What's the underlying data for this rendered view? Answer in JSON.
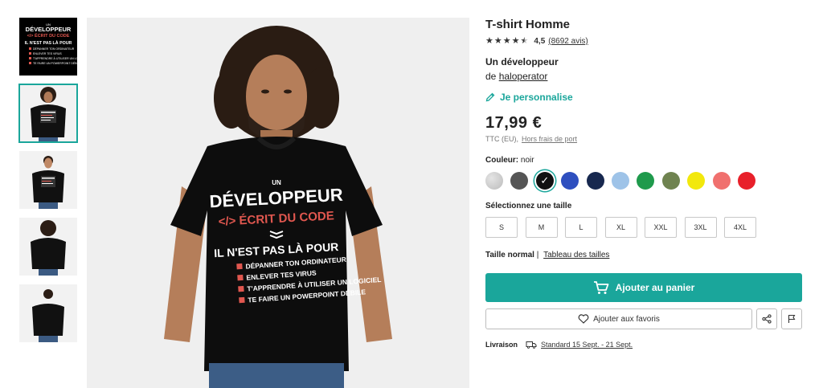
{
  "product": {
    "title": "T-shirt Homme",
    "rating_value": "4,5",
    "rating_count": "(8692 avis)",
    "design_name": "Un développeur",
    "designer_prefix": "de",
    "designer_name": "haloperator",
    "personalise_label": "Je personnalise",
    "price": "17,99 €",
    "price_tax_note": "TTC (EU),",
    "price_shipping_link": "Hors frais de port"
  },
  "color": {
    "label": "Couleur:",
    "selected_name": "noir",
    "swatches": [
      {
        "name": "heather-grey",
        "hex": "#c9c9c9"
      },
      {
        "name": "dark-grey",
        "hex": "#555555"
      },
      {
        "name": "black",
        "hex": "#111111"
      },
      {
        "name": "royal-blue",
        "hex": "#2e4fbf"
      },
      {
        "name": "navy",
        "hex": "#17284f"
      },
      {
        "name": "light-blue",
        "hex": "#9ec3e8"
      },
      {
        "name": "green",
        "hex": "#1f9a4c"
      },
      {
        "name": "olive",
        "hex": "#6f8350"
      },
      {
        "name": "yellow",
        "hex": "#f2e80c"
      },
      {
        "name": "coral",
        "hex": "#f0706e"
      },
      {
        "name": "red",
        "hex": "#e8202a"
      }
    ]
  },
  "size": {
    "label": "Sélectionnez une taille",
    "options": [
      "S",
      "M",
      "L",
      "XL",
      "XXL",
      "3XL",
      "4XL"
    ],
    "fit_label": "Taille normal",
    "fit_separator": "|",
    "size_chart_link": "Tableau des tailles"
  },
  "actions": {
    "add_to_cart": "Ajouter au panier",
    "add_to_favorites": "Ajouter aux favoris"
  },
  "delivery": {
    "label": "Livraison",
    "value": "Standard 15 Sept. - 21 Sept."
  },
  "design_print": {
    "line1": "UN",
    "line2": "DÉVELOPPEUR",
    "line3": "</> ÉCRIT DU CODE",
    "line4": "IL N'EST PAS LÀ POUR",
    "items": [
      "DÉPANNER TON ORDINATEUR",
      "ENLEVER TES VIRUS",
      "T'APPRENDRE À UTILISER UN LOGICIEL",
      "TE FAIRE UN POWERPOINT DÉBILE"
    ]
  },
  "colors": {
    "accent": "#1aa69b",
    "design_red": "#e0574f"
  }
}
